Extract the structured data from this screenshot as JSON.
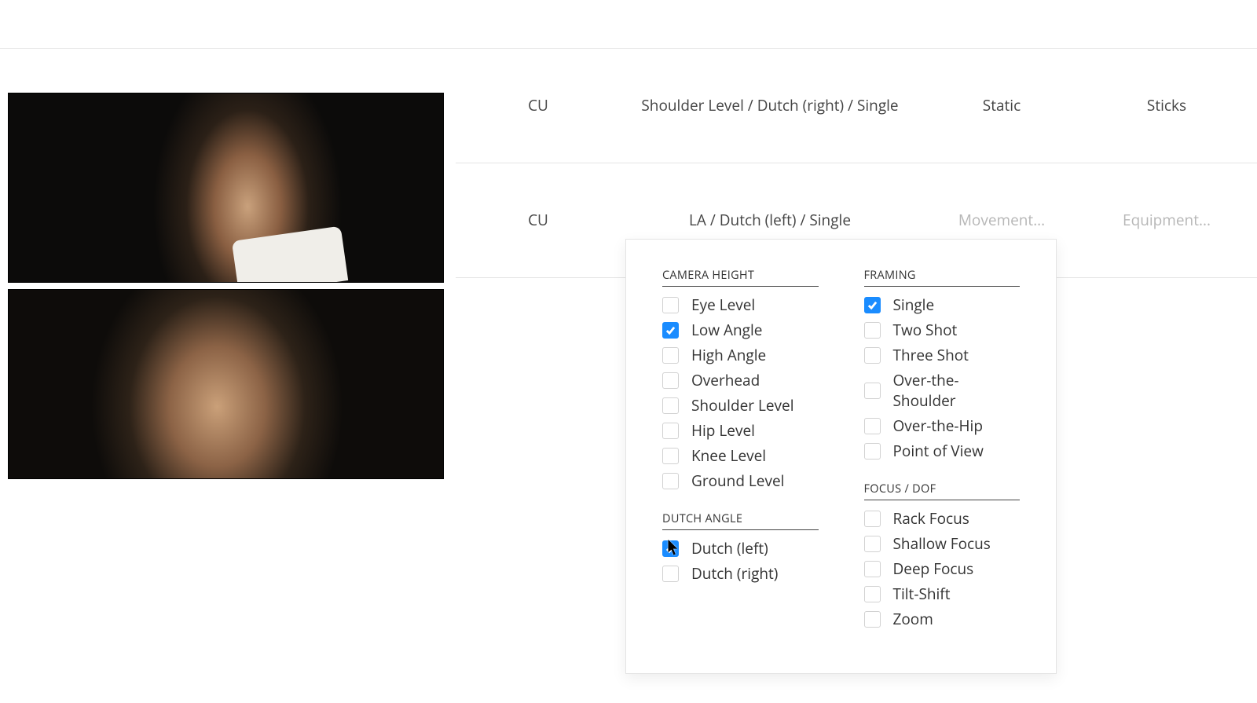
{
  "rows": [
    {
      "size": "CU",
      "angle": "Shoulder Level / Dutch (right) / Single",
      "movement": "Static",
      "equipment": "Sticks"
    },
    {
      "size": "CU",
      "angle": "LA / Dutch (left) / Single",
      "movement_placeholder": "Movement...",
      "equipment_placeholder": "Equipment..."
    }
  ],
  "dropdown": {
    "sections": {
      "camera_height": {
        "title": "CAMERA HEIGHT",
        "options": [
          {
            "label": "Eye Level",
            "checked": false
          },
          {
            "label": "Low Angle",
            "checked": true
          },
          {
            "label": "High Angle",
            "checked": false
          },
          {
            "label": "Overhead",
            "checked": false
          },
          {
            "label": "Shoulder Level",
            "checked": false
          },
          {
            "label": "Hip Level",
            "checked": false
          },
          {
            "label": "Knee Level",
            "checked": false
          },
          {
            "label": "Ground Level",
            "checked": false
          }
        ]
      },
      "dutch_angle": {
        "title": "DUTCH ANGLE",
        "options": [
          {
            "label": "Dutch (left)",
            "checked": true
          },
          {
            "label": "Dutch (right)",
            "checked": false
          }
        ]
      },
      "framing": {
        "title": "FRAMING",
        "options": [
          {
            "label": "Single",
            "checked": true
          },
          {
            "label": "Two Shot",
            "checked": false
          },
          {
            "label": "Three Shot",
            "checked": false
          },
          {
            "label": "Over-the-Shoulder",
            "checked": false
          },
          {
            "label": "Over-the-Hip",
            "checked": false
          },
          {
            "label": "Point of View",
            "checked": false
          }
        ]
      },
      "focus_dof": {
        "title": "FOCUS / DOF",
        "options": [
          {
            "label": "Rack Focus",
            "checked": false
          },
          {
            "label": "Shallow Focus",
            "checked": false
          },
          {
            "label": "Deep Focus",
            "checked": false
          },
          {
            "label": "Tilt-Shift",
            "checked": false
          },
          {
            "label": "Zoom",
            "checked": false
          }
        ]
      }
    }
  }
}
